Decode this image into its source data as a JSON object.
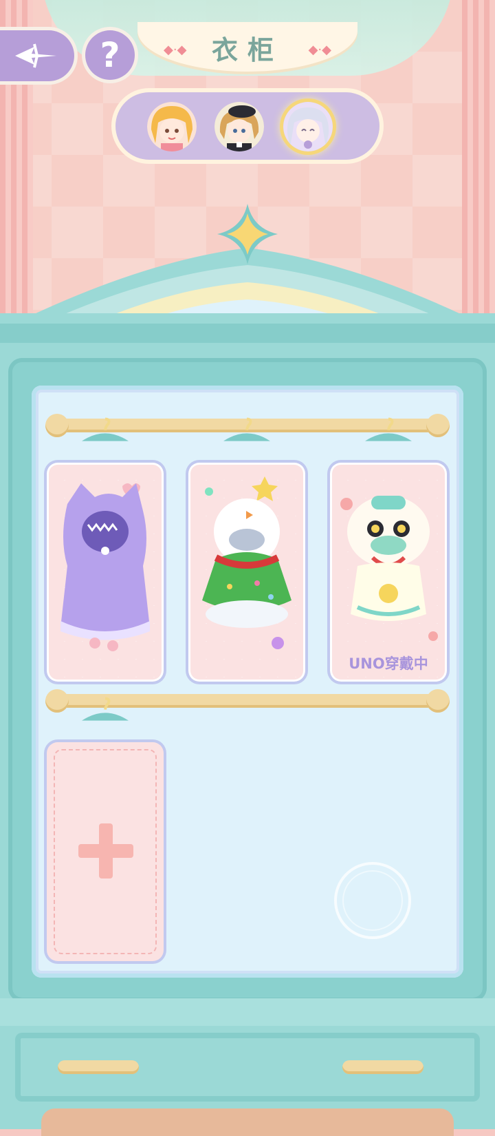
{
  "header": {
    "title": "衣柜"
  },
  "characters": [
    {
      "name": "character-1",
      "selected": false
    },
    {
      "name": "character-2",
      "selected": false
    },
    {
      "name": "character-3",
      "selected": true
    }
  ],
  "wardrobe": {
    "outfits": [
      {
        "icon": "purple-hooded-cloak-icon",
        "status": ""
      },
      {
        "icon": "christmas-tree-snowman-costume-icon",
        "status": ""
      },
      {
        "icon": "lion-dance-costume-icon",
        "status": "UNO穿戴中"
      }
    ],
    "add_slot_icon": "plus-icon"
  },
  "colors": {
    "accent_purple": "#b69ed8",
    "wardrobe_teal": "#9bd9d6",
    "card_pink": "#fbe2e2",
    "status_text": "#a894dc"
  }
}
